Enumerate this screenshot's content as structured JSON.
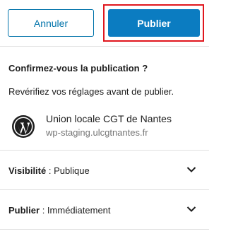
{
  "actions": {
    "cancel_label": "Annuler",
    "publish_label": "Publier"
  },
  "confirm": {
    "title": "Confirmez-vous la publication ?",
    "description": "Revérifiez vos réglages avant de publier.",
    "site": {
      "icon": "wordpress-logo-icon",
      "name": "Union locale CGT de Nantes",
      "url": "wp-staging.ulcgtnantes.fr"
    }
  },
  "rows": {
    "visibility": {
      "label": "Visibilité",
      "separator": " : ",
      "value": "Publique",
      "icon": "chevron-down-icon"
    },
    "publish": {
      "label": "Publier",
      "separator": " : ",
      "value": "Immédiatement",
      "icon": "chevron-down-icon"
    }
  },
  "colors": {
    "primary": "#0b7cc1",
    "outline": "#0073aa",
    "highlight": "#e0161d"
  }
}
